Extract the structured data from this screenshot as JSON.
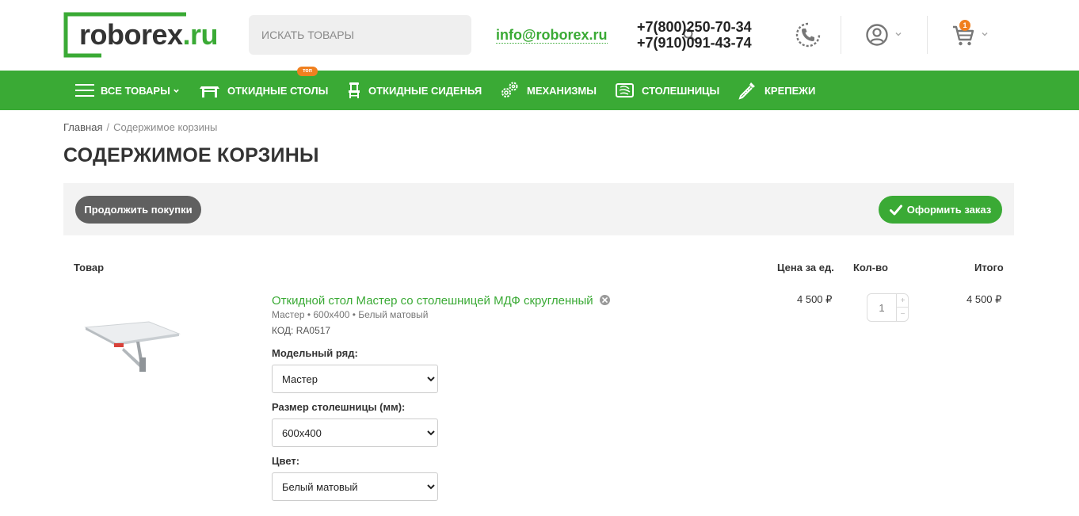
{
  "header": {
    "logo_text": "roborex",
    "logo_tld": ".ru",
    "search_placeholder": "ИСКАТЬ ТОВАРЫ",
    "email": "info@roborex.ru",
    "phone_1": "+7(800)250-70-34",
    "phone_2": "+7(910)091-43-74",
    "cart_count": "1"
  },
  "nav": {
    "items": [
      {
        "label": "ВСЕ ТОВАРЫ",
        "icon": "menu-icon"
      },
      {
        "label": "ОТКИДНЫЕ СТОЛЫ",
        "icon": "table-icon",
        "badge": "топ"
      },
      {
        "label": "ОТКИДНЫЕ СИДЕНЬЯ",
        "icon": "chair-icon"
      },
      {
        "label": "МЕХАНИЗМЫ",
        "icon": "gears-icon"
      },
      {
        "label": "СТОЛЕШНИЦЫ",
        "icon": "wood-icon"
      },
      {
        "label": "КРЕПЕЖИ",
        "icon": "screw-icon"
      }
    ]
  },
  "breadcrumb": {
    "home": "Главная",
    "separator": "/",
    "current": "Содержимое корзины"
  },
  "page_title": "СОДЕРЖИМОЕ КОРЗИНЫ",
  "actions": {
    "continue_label": "Продолжить покупки",
    "order_label": "Оформить заказ"
  },
  "table": {
    "col_product": "Товар",
    "col_price": "Цена за ед.",
    "col_qty": "Кол-во",
    "col_total": "Итого"
  },
  "item": {
    "name": "Откидной стол Мастер со столешницей МДФ скругленный",
    "variant": "Мастер • 600х400 • Белый матовый",
    "code": "КОД: RA0517",
    "price": "4 500 ₽",
    "quantity": "1",
    "total": "4 500 ₽",
    "options": [
      {
        "label": "Модельный ряд:",
        "value": "Мастер"
      },
      {
        "label": "Размер столешницы (мм):",
        "value": "600х400"
      },
      {
        "label": "Цвет:",
        "value": "Белый матовый"
      }
    ]
  },
  "colors": {
    "brand_green": "#3aaa35",
    "accent_orange": "#f0801f",
    "button_gray": "#606060"
  }
}
